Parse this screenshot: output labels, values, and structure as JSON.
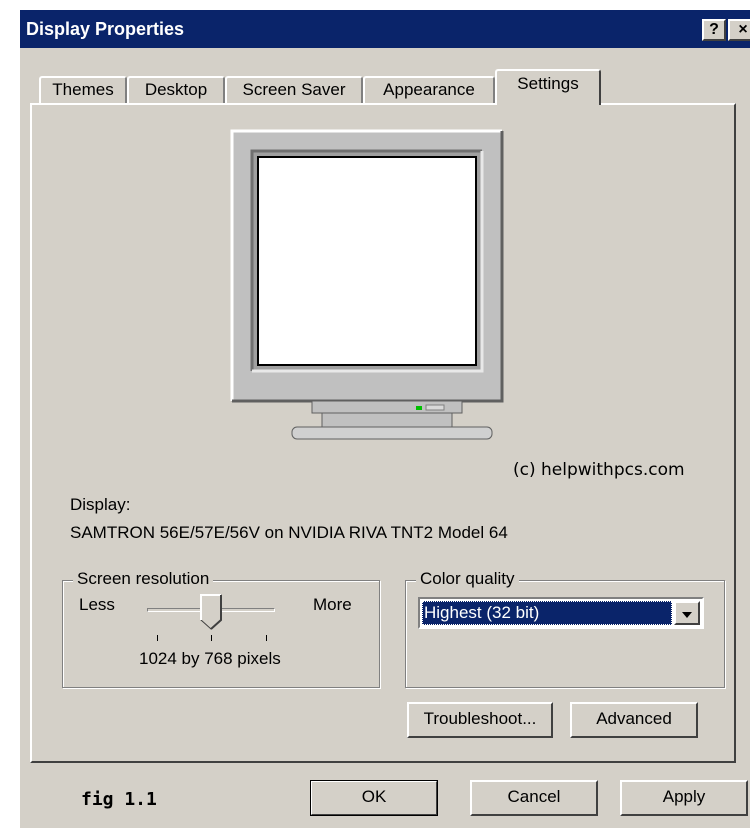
{
  "window": {
    "title": "Display Properties",
    "help_button": "?",
    "close_button": "×"
  },
  "tabs": [
    {
      "label": "Themes",
      "active": false
    },
    {
      "label": "Desktop",
      "active": false
    },
    {
      "label": "Screen Saver",
      "active": false
    },
    {
      "label": "Appearance",
      "active": false
    },
    {
      "label": "Settings",
      "active": true
    }
  ],
  "settings": {
    "copyright": "(c) helpwithpcs.com",
    "display_label": "Display:",
    "display_device": "SAMTRON 56E/57E/56V on NVIDIA RIVA TNT2 Model 64",
    "screen_resolution": {
      "title": "Screen resolution",
      "less_label": "Less",
      "more_label": "More",
      "value_text": "1024 by 768 pixels",
      "slider_position": 0.5
    },
    "color_quality": {
      "title": "Color quality",
      "selected": "Highest (32 bit)"
    },
    "troubleshoot_label": "Troubleshoot...",
    "advanced_label": "Advanced"
  },
  "footer": {
    "fig_label": "fig 1.1",
    "ok_label": "OK",
    "cancel_label": "Cancel",
    "apply_label": "Apply"
  },
  "colors": {
    "titlebar": "#0a246a",
    "face": "#d4d0c8",
    "selection": "#0a246a"
  }
}
